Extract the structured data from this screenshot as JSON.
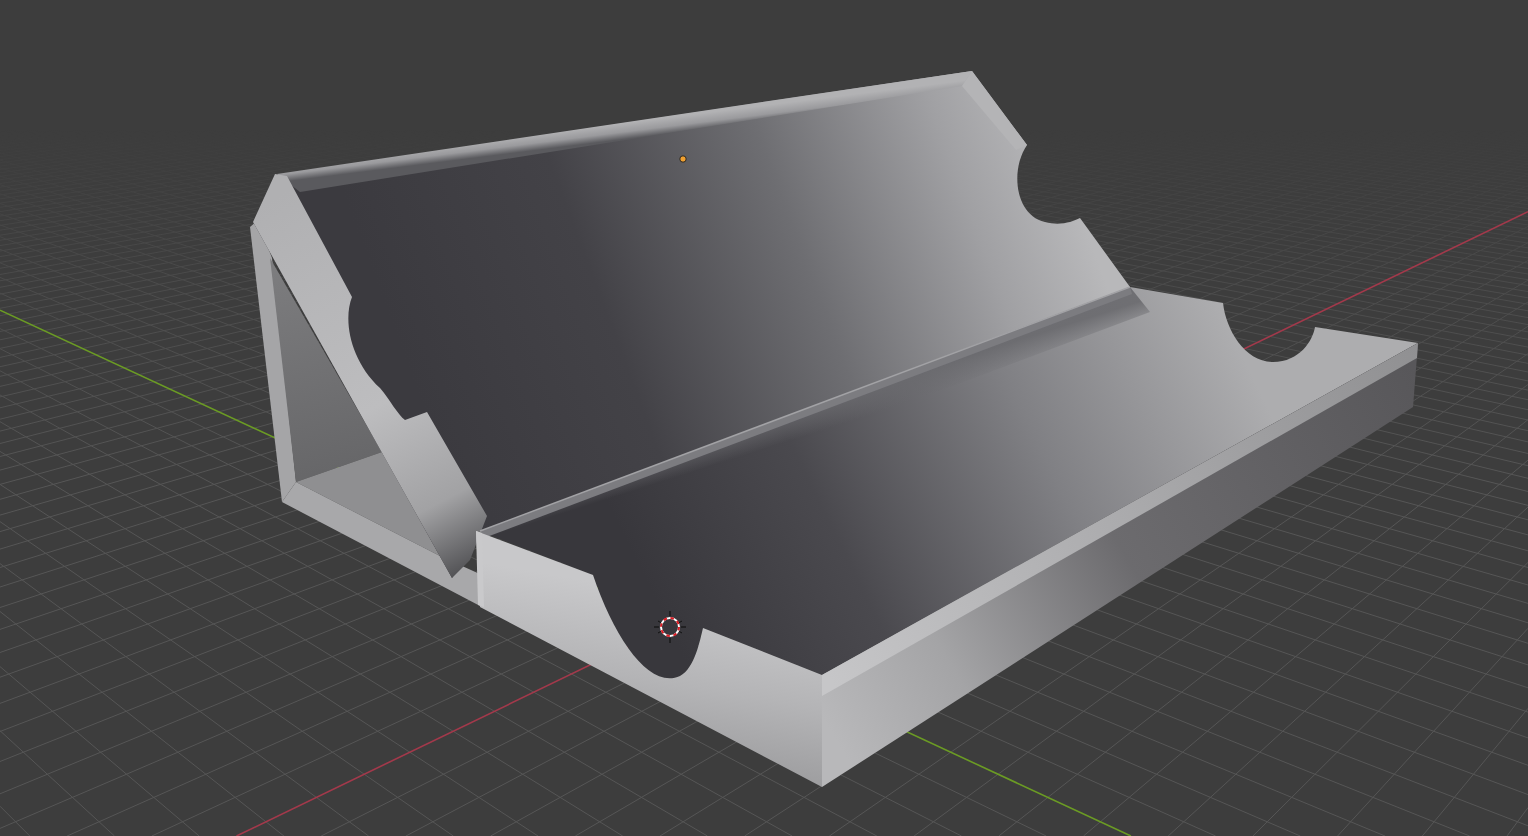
{
  "viewport": {
    "axis_lines": [
      {
        "color": "#a3394b"
      },
      {
        "color": "#6b9b24"
      }
    ]
  },
  "object": {
    "selected": true
  }
}
